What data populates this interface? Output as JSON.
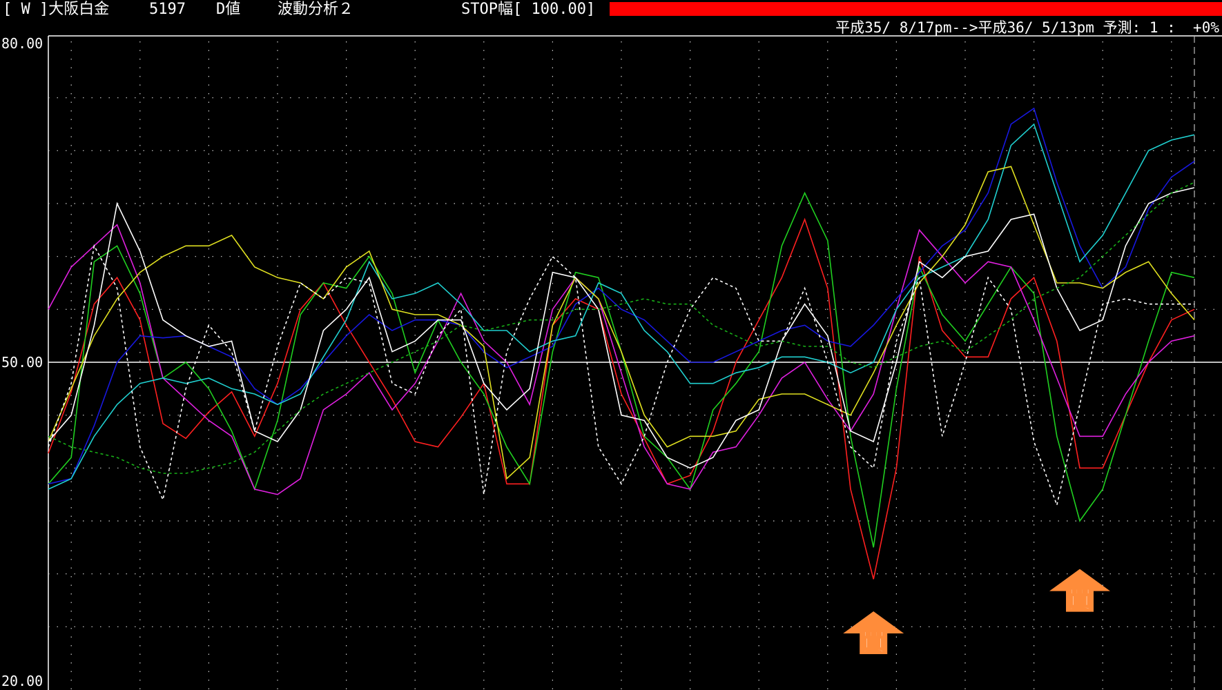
{
  "header": {
    "symbol": "[ W ]大阪白金",
    "code": "5197",
    "mode": "D値",
    "analysis": "波動分析２",
    "stop_label": "STOP幅[ 100.00]",
    "stop_bar_color": "#ff0000",
    "period": "平成35/ 8/17pm-->平成36/ 5/13pm 予測: 1 :  +0%"
  },
  "colors": {
    "background": "#000000",
    "grid": "#cfcfcf",
    "frame": "#ffffff",
    "buy_marker": "#ff8c3a"
  },
  "chart_data": {
    "type": "line",
    "ylim": [
      20,
      80
    ],
    "yticks": [
      "80.00",
      "50.00",
      "20.00"
    ],
    "midline": 50,
    "x": [
      0,
      1,
      2,
      3,
      4,
      5,
      6,
      7,
      8,
      9,
      10,
      11,
      12,
      13,
      14,
      15,
      16,
      17,
      18,
      19,
      20,
      21,
      22,
      23,
      24,
      25,
      26,
      27,
      28,
      29,
      30,
      31,
      32,
      33,
      34,
      35,
      36,
      37,
      38,
      39,
      40,
      41,
      42,
      43,
      44,
      45,
      46,
      47,
      48,
      49,
      50
    ],
    "series": [
      {
        "color": "#ff2020",
        "dash": false,
        "values": [
          41.4,
          47.2,
          55.5,
          58.0,
          54.0,
          44.2,
          42.8,
          45.3,
          47.2,
          43.0,
          48.0,
          55.0,
          57.5,
          53.5,
          50.0,
          46.5,
          42.5,
          42.0,
          44.8,
          48.0,
          38.5,
          38.5,
          53.5,
          56.0,
          55.0,
          47.0,
          42.8,
          38.5,
          39.3,
          43.5,
          50.0,
          54.0,
          58.0,
          63.5,
          57.0,
          38.0,
          29.5,
          40.0,
          60.0,
          53.0,
          50.5,
          50.5,
          56.0,
          58.0,
          52.0,
          40.0,
          40.0,
          45.0,
          50.0,
          54.0,
          55.0
        ]
      },
      {
        "color": "#20d020",
        "dash": false,
        "values": [
          38.5,
          41.0,
          59.5,
          61.0,
          56.5,
          48.5,
          50.0,
          47.5,
          43.5,
          38.0,
          44.5,
          54.5,
          57.5,
          57.0,
          60.0,
          56.5,
          49.0,
          54.0,
          50.0,
          47.0,
          42.0,
          38.5,
          51.0,
          58.5,
          58.0,
          51.0,
          43.0,
          41.0,
          38.0,
          45.5,
          48.0,
          51.0,
          61.0,
          66.0,
          61.5,
          43.0,
          32.5,
          47.5,
          59.0,
          54.5,
          52.0,
          55.5,
          59.0,
          56.5,
          43.0,
          35.0,
          38.0,
          45.0,
          52.0,
          58.5,
          58.0
        ]
      },
      {
        "color": "#e020e0",
        "dash": false,
        "values": [
          55.0,
          59.0,
          61.0,
          63.0,
          57.5,
          48.5,
          46.5,
          44.5,
          43.0,
          38.0,
          37.5,
          39.0,
          45.5,
          47.0,
          49.0,
          45.5,
          48.0,
          52.0,
          56.5,
          52.0,
          50.0,
          46.0,
          55.0,
          58.0,
          56.0,
          49.0,
          42.0,
          38.5,
          38.0,
          41.5,
          42.0,
          45.0,
          48.5,
          50.0,
          46.5,
          43.5,
          47.0,
          55.0,
          62.5,
          60.0,
          57.5,
          59.5,
          59.0,
          54.0,
          48.5,
          43.0,
          43.0,
          47.0,
          50.0,
          52.0,
          52.5
        ]
      },
      {
        "color": "#1818e0",
        "dash": false,
        "values": [
          38.5,
          39.0,
          44.0,
          50.0,
          52.5,
          52.3,
          52.5,
          51.5,
          50.5,
          47.5,
          46.0,
          47.5,
          50.0,
          52.5,
          54.5,
          53.0,
          54.0,
          54.0,
          53.5,
          51.0,
          49.5,
          50.5,
          51.5,
          55.5,
          57.0,
          55.0,
          54.0,
          52.0,
          50.0,
          50.0,
          51.0,
          52.0,
          53.0,
          53.5,
          52.0,
          51.5,
          53.5,
          56.0,
          58.5,
          61.0,
          62.5,
          66.0,
          72.5,
          74.0,
          67.0,
          61.0,
          57.0,
          59.0,
          64.5,
          67.5,
          69.0
        ]
      },
      {
        "color": "#20d0d0",
        "dash": false,
        "values": [
          38.0,
          39.0,
          43.0,
          46.0,
          48.0,
          48.5,
          48.0,
          48.5,
          47.5,
          47.0,
          46.0,
          47.0,
          50.5,
          54.0,
          59.5,
          56.0,
          56.5,
          57.5,
          55.5,
          53.0,
          53.0,
          51.0,
          52.0,
          52.5,
          57.5,
          56.5,
          53.0,
          51.0,
          48.0,
          48.0,
          49.0,
          49.5,
          50.5,
          50.5,
          50.0,
          49.0,
          50.0,
          55.0,
          58.0,
          59.0,
          60.0,
          63.5,
          70.5,
          72.5,
          66.0,
          59.5,
          62.0,
          66.0,
          70.0,
          71.0,
          71.5
        ]
      },
      {
        "color": "#e0e020",
        "dash": false,
        "values": [
          42.5,
          47.5,
          52.5,
          56.0,
          58.5,
          60.0,
          61.0,
          61.0,
          62.0,
          59.0,
          58.0,
          57.5,
          56.0,
          59.0,
          60.5,
          55.0,
          54.5,
          54.5,
          53.5,
          51.5,
          39.0,
          41.0,
          53.5,
          58.0,
          56.0,
          51.0,
          45.0,
          42.0,
          43.0,
          43.0,
          43.5,
          46.5,
          47.0,
          47.0,
          46.0,
          45.0,
          49.0,
          53.5,
          57.5,
          60.0,
          63.0,
          68.0,
          68.5,
          63.0,
          57.5,
          57.5,
          57.0,
          58.5,
          59.5,
          56.5,
          54.0
        ]
      },
      {
        "color": "#ffffff",
        "dash": false,
        "values": [
          42.5,
          45.0,
          53.5,
          65.0,
          60.5,
          54.0,
          52.5,
          51.5,
          52.0,
          43.5,
          42.5,
          45.5,
          53.0,
          55.0,
          58.0,
          51.0,
          52.0,
          54.0,
          54.0,
          48.0,
          45.5,
          47.5,
          58.5,
          58.0,
          55.0,
          45.0,
          44.5,
          41.0,
          40.0,
          41.0,
          44.5,
          45.5,
          52.0,
          55.5,
          52.5,
          43.5,
          42.5,
          50.0,
          59.5,
          58.0,
          60.0,
          60.5,
          63.5,
          64.0,
          57.0,
          53.0,
          54.0,
          61.0,
          65.0,
          66.0,
          66.5
        ]
      },
      {
        "color": "#ffffff",
        "dash": true,
        "values": [
          42.0,
          48.0,
          61.0,
          57.0,
          42.0,
          37.0,
          47.5,
          53.5,
          51.0,
          43.5,
          51.5,
          57.5,
          56.0,
          58.0,
          57.5,
          48.0,
          47.0,
          52.5,
          55.0,
          37.5,
          51.0,
          56.0,
          60.0,
          58.0,
          42.0,
          38.5,
          43.0,
          50.0,
          55.0,
          58.0,
          57.0,
          52.0,
          52.0,
          57.0,
          50.0,
          42.0,
          40.0,
          52.0,
          58.0,
          43.0,
          50.0,
          58.0,
          55.0,
          42.5,
          36.5,
          46.0,
          55.5,
          56.0,
          55.5,
          55.5,
          55.5
        ]
      },
      {
        "color": "#18b018",
        "dash": true,
        "values": [
          43.0,
          42.0,
          41.5,
          41.0,
          40.0,
          39.5,
          39.5,
          40.0,
          40.5,
          41.5,
          43.5,
          45.5,
          47.0,
          48.0,
          49.0,
          50.0,
          51.0,
          52.0,
          53.5,
          53.0,
          53.5,
          54.0,
          54.0,
          55.0,
          55.0,
          55.5,
          56.0,
          55.5,
          55.5,
          53.5,
          52.5,
          51.5,
          52.0,
          51.5,
          51.5,
          50.0,
          49.5,
          50.5,
          51.5,
          52.0,
          51.0,
          52.5,
          54.0,
          56.0,
          57.0,
          58.0,
          60.0,
          62.0,
          64.0,
          66.0,
          67.0
        ]
      }
    ],
    "markers": [
      {
        "label": "買",
        "index": 36,
        "value": 24.5
      },
      {
        "label": "買",
        "index": 45,
        "value": 28.5
      }
    ]
  }
}
